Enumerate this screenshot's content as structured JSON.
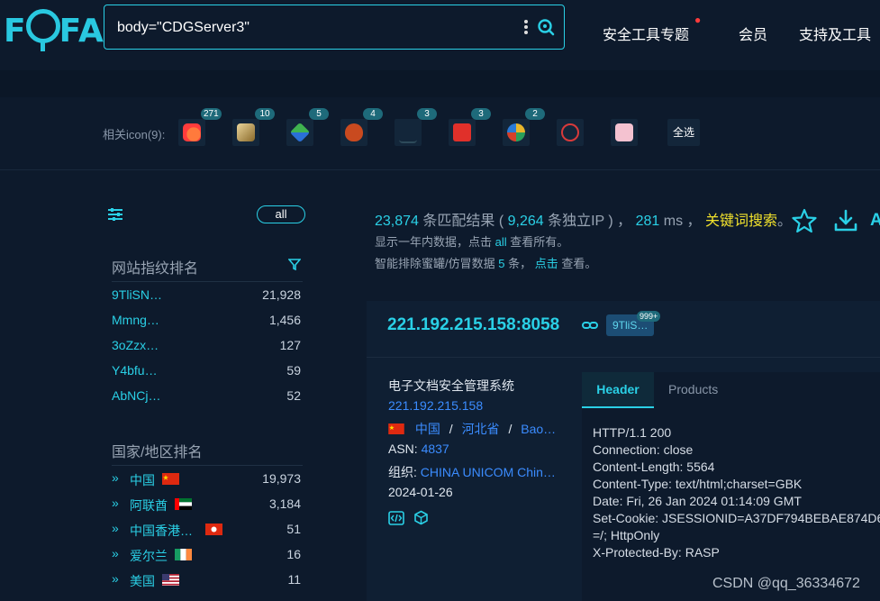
{
  "logo": {
    "letters": [
      "F",
      "FA"
    ]
  },
  "search": {
    "query": "body=\"CDGServer3\""
  },
  "nav": {
    "items": [
      "安全工具专题",
      "会员",
      "支持及工具"
    ]
  },
  "icons": {
    "label": "相关icon(9):",
    "counts": [
      "271",
      "10",
      "5",
      "4",
      "3",
      "3",
      "2"
    ],
    "select_all": "全选"
  },
  "sidebar": {
    "all_label": "all",
    "fingerprint_title": "网站指纹排名",
    "fingerprints": [
      {
        "name": "9TliSN…",
        "count": "21,928"
      },
      {
        "name": "Mmng…",
        "count": "1,456"
      },
      {
        "name": "3oZzx…",
        "count": "127"
      },
      {
        "name": "Y4bfu…",
        "count": "59"
      },
      {
        "name": "AbNCj…",
        "count": "52"
      }
    ],
    "country_title": "国家/地区排名",
    "countries": [
      {
        "name": "中国",
        "count": "19,973",
        "flag": "cn"
      },
      {
        "name": "阿联酋",
        "count": "3,184",
        "flag": "ae"
      },
      {
        "name": "中国香港…",
        "count": "51",
        "flag": "hk"
      },
      {
        "name": "爱尔兰",
        "count": "16",
        "flag": "ie"
      },
      {
        "name": "美国",
        "count": "11",
        "flag": "us"
      }
    ]
  },
  "summary": {
    "total": "23,874",
    "t1": " 条匹配结果 ( ",
    "ips": "9,264",
    "t2": " 条独立IP ) ， ",
    "ms": "281",
    "t3": " ms ， ",
    "keyword": "关键词搜索",
    "t4": "。",
    "line2_a": "显示一年内数据，点击 ",
    "line2_link": "all",
    "line2_b": " 查看所有。",
    "line3_a": "智能排除蜜罐/仿冒数据 ",
    "line3_count": "5",
    "line3_b": " 条， ",
    "line3_link": "点击",
    "line3_c": " 查看。",
    "extra_letter": "A"
  },
  "result": {
    "ipport": "221.192.215.158:8058",
    "tag": "9TliS…",
    "tag_badge": "999+",
    "title": "电子文档安全管理系统",
    "ip": "221.192.215.158",
    "country": "中国",
    "sep": "/",
    "province": "河北省",
    "city": "Bao…",
    "asn_label": "ASN: ",
    "asn": "4837",
    "org_label": "组织: ",
    "org": "CHINA UNICOM Chin…",
    "date": "2024-01-26",
    "tabs": [
      "Header",
      "Products"
    ],
    "header_lines": [
      "HTTP/1.1 200",
      "Connection: close",
      "Content-Length: 5564",
      "Content-Type: text/html;charset=GBK",
      "Date: Fri, 26 Jan 2024 01:14:09 GMT",
      "Set-Cookie: JSESSIONID=A37DF794BEBAE874D6",
      "=/; HttpOnly",
      "X-Protected-By: RASP"
    ]
  },
  "watermark": "CSDN @qq_36334672",
  "colors": {
    "accent": "#2ad0e6",
    "keyword": "#f0e02c",
    "link": "#3b8cff",
    "background": "#0d1a2c"
  }
}
